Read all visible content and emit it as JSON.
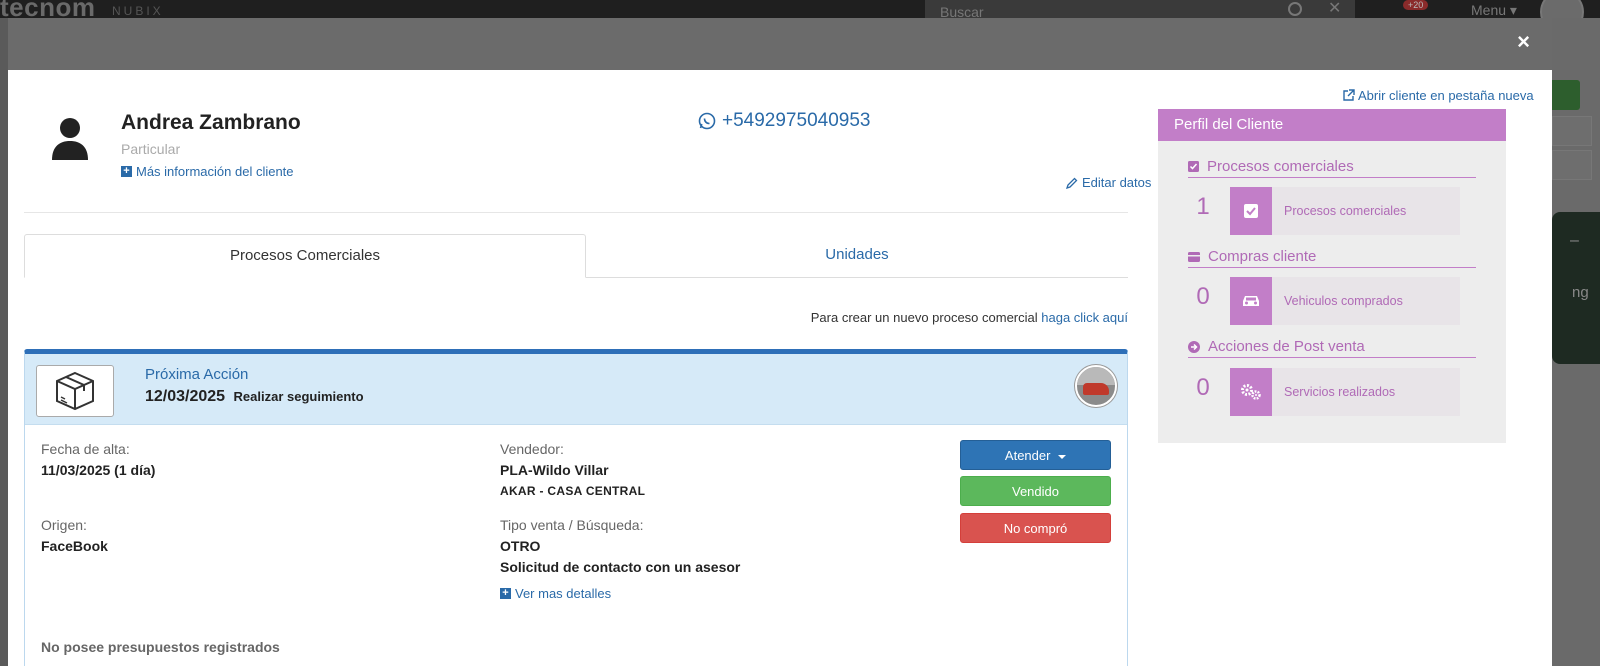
{
  "background": {
    "logo": "tecnom",
    "logo_sub": "NUBIX",
    "search_placeholder": "Buscar",
    "search_clear": "✕",
    "notif_badge": "+20",
    "menu_label": "Menu ▾",
    "right_fragment": "ng",
    "right_dash": "–"
  },
  "modal": {
    "close": "×",
    "open_tab_link": "Abrir cliente en pestaña nueva",
    "client": {
      "name": "Andrea Zambrano",
      "type": "Particular",
      "more_info": "Más información del cliente",
      "phone": "+5492975040953",
      "edit": "Editar datos"
    },
    "tabs": [
      {
        "label": "Procesos Comerciales",
        "active": true
      },
      {
        "label": "Unidades",
        "active": false
      }
    ],
    "create_text": "Para crear un nuevo proceso comercial",
    "create_link": "haga click aquí",
    "process": {
      "next_action_label": "Próxima Acción",
      "next_action_date": "12/03/2025",
      "next_action_text": "Realizar seguimiento",
      "fecha_alta_label": "Fecha de alta:",
      "fecha_alta_value": "11/03/2025 (1 día)",
      "origen_label": "Origen:",
      "origen_value": "FaceBook",
      "vendedor_label": "Vendedor:",
      "vendedor_value": "PLA-Wildo Villar",
      "vendedor_sub": "AKAR - CASA CENTRAL",
      "tipo_label": "Tipo venta / Búsqueda:",
      "tipo_value": "OTRO",
      "tipo_detail": "Solicitud de contacto con un asesor",
      "more_details": "Ver mas detalles",
      "no_quotes": "No posee presupuestos registrados",
      "buttons": {
        "attend": "Atender",
        "sold": "Vendido",
        "no_buy": "No compró"
      }
    }
  },
  "profile": {
    "title": "Perfil del Cliente",
    "sections": [
      {
        "title": "Procesos comerciales",
        "count": "1",
        "tile": "Procesos comerciales",
        "icon": "check-square-icon"
      },
      {
        "title": "Compras cliente",
        "count": "0",
        "tile": "Vehiculos comprados",
        "icon": "car-icon"
      },
      {
        "title": "Acciones de Post venta",
        "count": "0",
        "tile": "Servicios realizados",
        "icon": "gears-icon"
      }
    ]
  },
  "colors": {
    "accent_blue": "#2a6aa8",
    "profile_purple": "#c27ec8",
    "btn_blue": "#2e74b5",
    "btn_green": "#5cb85c",
    "btn_red": "#d9534f"
  }
}
